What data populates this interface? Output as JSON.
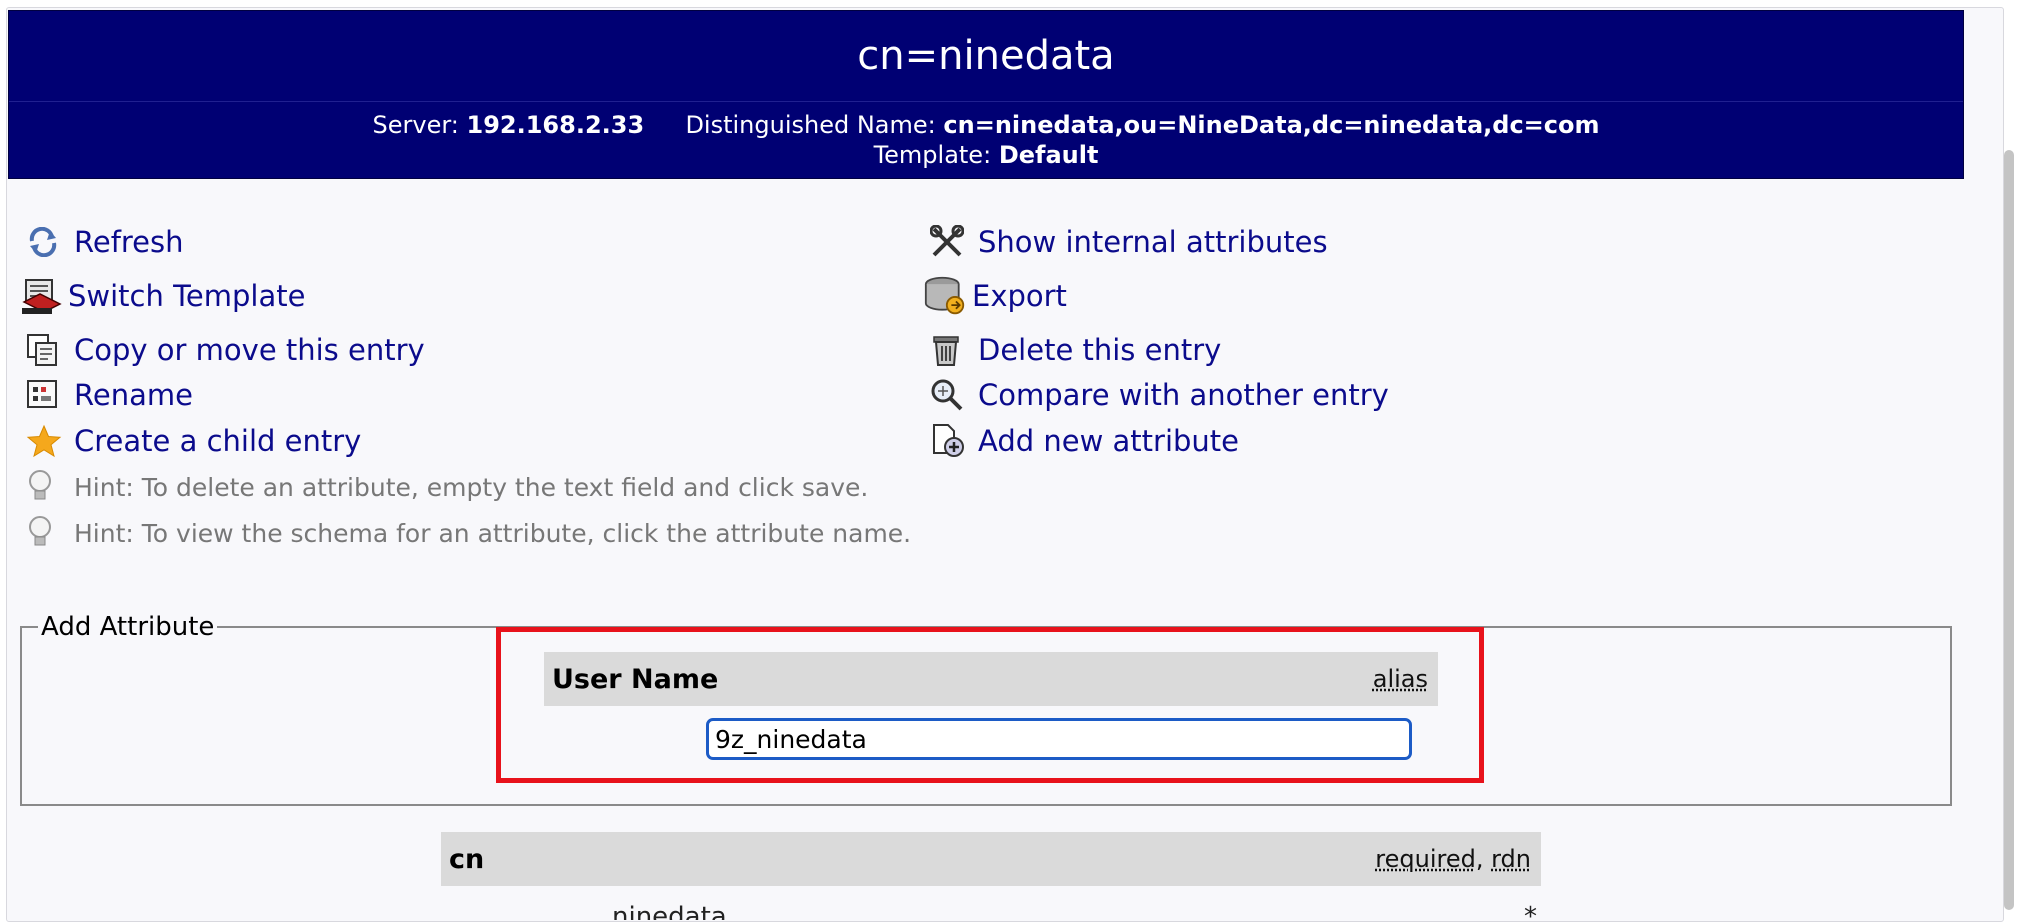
{
  "header": {
    "title": "cn=ninedata",
    "server_label": "Server:",
    "server_value": "192.168.2.33",
    "dn_label": "Distinguished Name:",
    "dn_value": "cn=ninedata,ou=NineData,dc=ninedata,dc=com",
    "template_label": "Template:",
    "template_value": "Default"
  },
  "actions_left": [
    {
      "label": "Refresh",
      "icon": "refresh-icon"
    },
    {
      "label": "Switch Template",
      "icon": "switch-template-icon"
    },
    {
      "label": "Copy or move this entry",
      "icon": "copy-icon"
    },
    {
      "label": "Rename",
      "icon": "rename-icon"
    },
    {
      "label": "Create a child entry",
      "icon": "star-icon"
    }
  ],
  "actions_right": [
    {
      "label": "Show internal attributes",
      "icon": "tools-icon"
    },
    {
      "label": "Export",
      "icon": "export-icon"
    },
    {
      "label": "Delete this entry",
      "icon": "trash-icon"
    },
    {
      "label": "Compare with another entry",
      "icon": "compare-icon"
    },
    {
      "label": "Add new attribute",
      "icon": "add-attribute-icon"
    }
  ],
  "hints": [
    "Hint: To delete an attribute, empty the text field and click save.",
    "Hint: To view the schema for an attribute, click the attribute name."
  ],
  "add_attribute": {
    "legend": "Add Attribute",
    "name": "User Name",
    "flag": "alias",
    "value": "9z_ninedata"
  },
  "cn_attribute": {
    "name": "cn",
    "flag_required": "required",
    "separator": ",",
    "flag_rdn": "rdn",
    "peek_value": "ninedata",
    "peek_star": "*"
  }
}
